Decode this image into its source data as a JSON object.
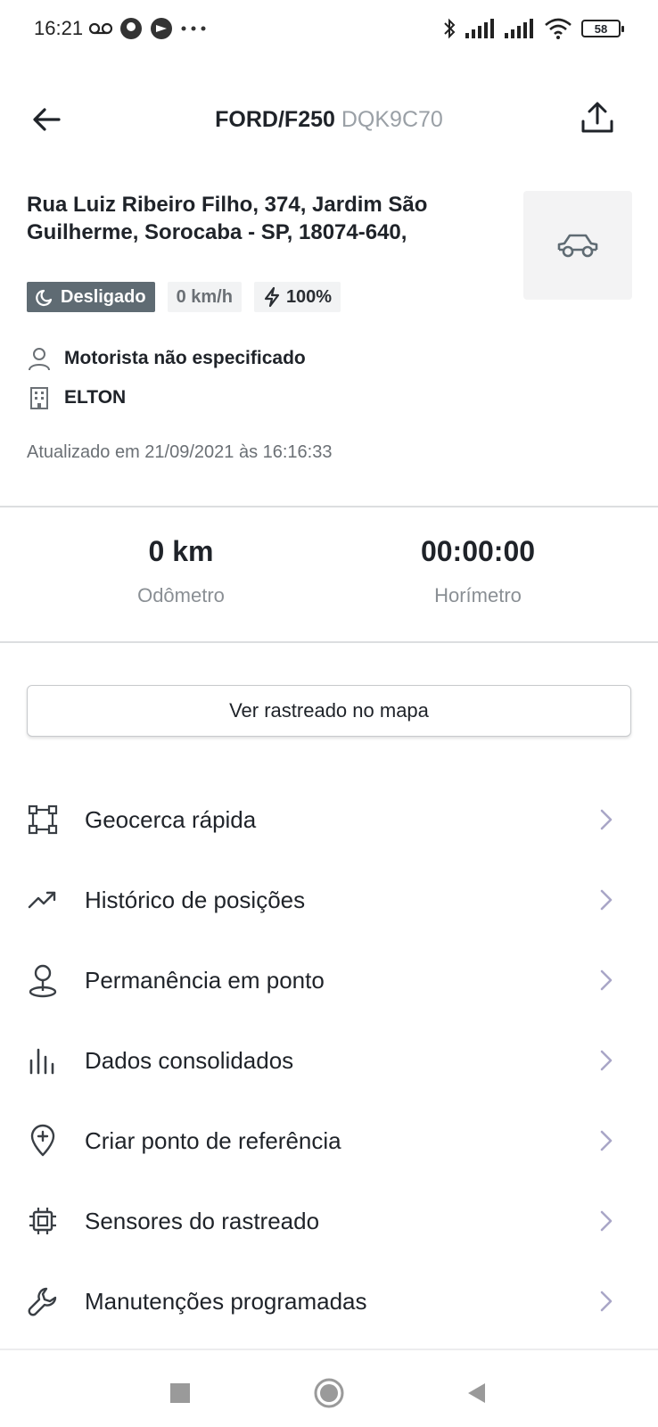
{
  "status_bar": {
    "time": "16:21",
    "battery": "58"
  },
  "header": {
    "title": "FORD/F250",
    "plate": "DQK9C70"
  },
  "address": "Rua Luiz Ribeiro Filho, 374, Jardim São Guilherme, Sorocaba - SP, 18074-640,",
  "badges": {
    "status": "Desligado",
    "speed": "0 km/h",
    "battery": "100%"
  },
  "driver": "Motorista não especificado",
  "company": "ELTON",
  "updated": "Atualizado em 21/09/2021 às 16:16:33",
  "stats": {
    "odometer_value": "0 km",
    "odometer_label": "Odômetro",
    "hourmeter_value": "00:00:00",
    "hourmeter_label": "Horímetro"
  },
  "map_button": "Ver rastreado no mapa",
  "menu": [
    {
      "label": "Geocerca rápida",
      "icon": "geofence-icon"
    },
    {
      "label": "Histórico de posições",
      "icon": "trending-icon"
    },
    {
      "label": "Permanência em ponto",
      "icon": "location-pin-icon"
    },
    {
      "label": "Dados consolidados",
      "icon": "bar-chart-icon"
    },
    {
      "label": "Criar ponto de referência",
      "icon": "add-location-icon"
    },
    {
      "label": "Sensores do rastreado",
      "icon": "chip-icon"
    },
    {
      "label": "Manutenções programadas",
      "icon": "wrench-icon"
    }
  ],
  "colors": {
    "text": "#1f2329",
    "muted": "#8a8f94",
    "badge_off": "#5f6b73",
    "chevron": "#a9a6c7"
  }
}
